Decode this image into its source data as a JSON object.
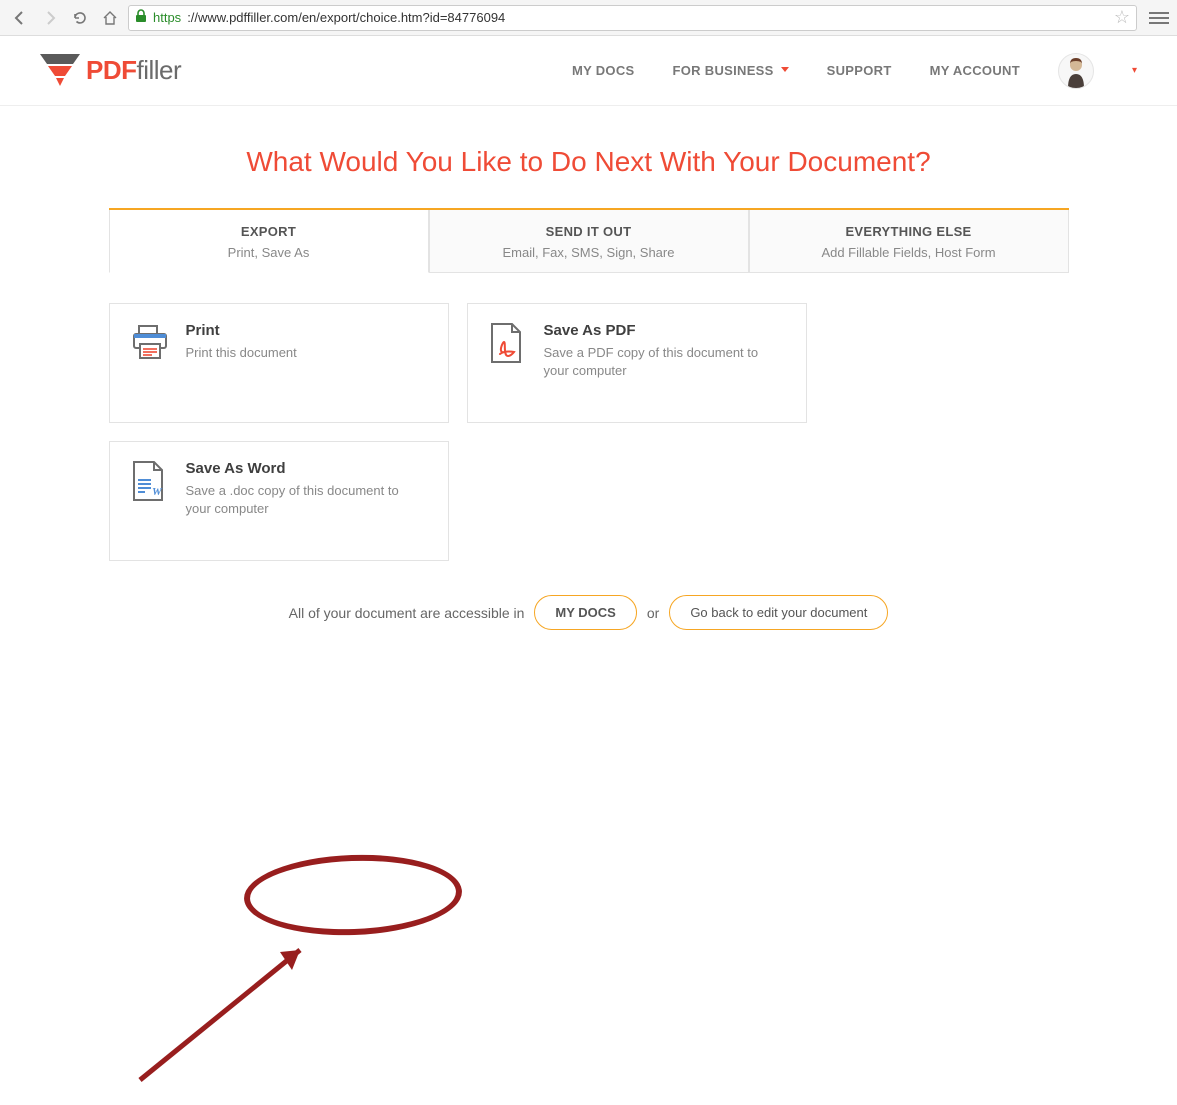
{
  "browser": {
    "url_protocol": "https",
    "url_rest": "://www.pdffiller.com/en/export/choice.htm?id=84776094"
  },
  "logo": {
    "brand": "PDF",
    "suffix": "filler"
  },
  "nav": {
    "my_docs": "MY DOCS",
    "for_business": "FOR BUSINESS",
    "support": "SUPPORT",
    "my_account": "MY ACCOUNT"
  },
  "page_title": "What Would You Like to Do Next With Your Document?",
  "tabs": [
    {
      "title": "EXPORT",
      "sub": "Print, Save As"
    },
    {
      "title": "SEND IT OUT",
      "sub": "Email, Fax, SMS, Sign, Share"
    },
    {
      "title": "EVERYTHING ELSE",
      "sub": "Add Fillable Fields, Host Form"
    }
  ],
  "cards": [
    {
      "title": "Print",
      "desc": "Print this document"
    },
    {
      "title": "Save As PDF",
      "desc": "Save a PDF copy of this document to your computer"
    },
    {
      "title": "Save As Word",
      "desc": "Save a .doc copy of this document to your computer"
    }
  ],
  "footer": {
    "prefix": "All of your document are accessible in",
    "my_docs": "MY DOCS",
    "or": "or",
    "go_back": "Go back to edit your document"
  }
}
